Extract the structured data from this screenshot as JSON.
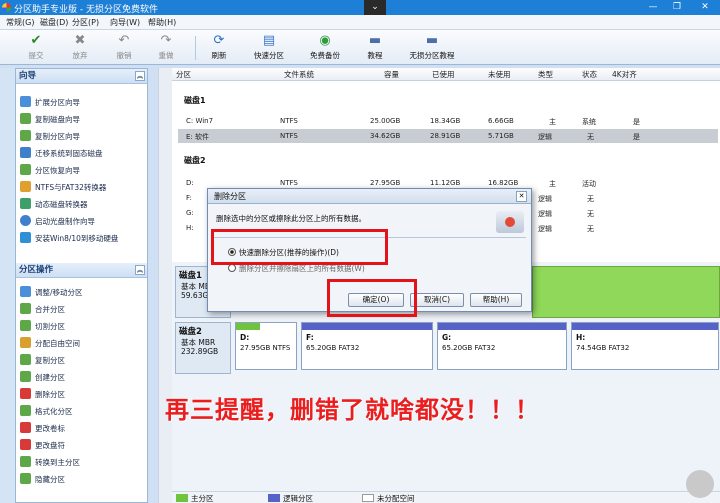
{
  "app": {
    "title": "分区助手专业版 - 无损分区免费软件"
  },
  "menu": [
    "常规(G)",
    "磁盘(D)",
    "分区(P)",
    "向导(W)",
    "帮助(H)"
  ],
  "toolbar": {
    "items": [
      {
        "label": "提交",
        "icon": "check-icon"
      },
      {
        "label": "放弃",
        "icon": "discard-icon"
      },
      {
        "label": "撤销",
        "icon": "undo-icon"
      },
      {
        "label": "重做",
        "icon": "redo-icon"
      },
      {
        "label": "刷新",
        "icon": "refresh-icon"
      },
      {
        "label": "快速分区",
        "icon": "quick-partition-icon"
      },
      {
        "label": "免费备份",
        "icon": "backup-icon"
      },
      {
        "label": "教程",
        "icon": "tutorial-icon"
      },
      {
        "label": "无损分区教程",
        "icon": "lossless-tutorial-icon"
      }
    ]
  },
  "sidebar": {
    "wizard_title": "向导",
    "wizard_items": [
      "扩展分区向导",
      "复制磁盘向导",
      "复制分区向导",
      "迁移系统到固态磁盘",
      "分区恢复向导",
      "NTFS与FAT32转换器",
      "动态磁盘转换器",
      "启动光盘制作向导",
      "安装Win8/10到移动硬盘"
    ],
    "ops_title": "分区操作",
    "ops_items": [
      "调整/移动分区",
      "合并分区",
      "切割分区",
      "分配自由空间",
      "复制分区",
      "创建分区",
      "删除分区",
      "格式化分区",
      "更改卷标",
      "更改盘符",
      "转换到主分区",
      "隐藏分区"
    ]
  },
  "columns": [
    "分区",
    "文件系统",
    "容量",
    "已使用",
    "未使用",
    "类型",
    "状态",
    "4K对齐"
  ],
  "disk1": {
    "name": "磁盘1",
    "rows": [
      {
        "part": "C: Win7",
        "fs": "NTFS",
        "cap": "25.00GB",
        "used": "18.34GB",
        "free": "6.66GB",
        "type": "主",
        "status": "系统",
        "align": "是"
      },
      {
        "part": "E: 软件",
        "fs": "NTFS",
        "cap": "34.62GB",
        "used": "28.91GB",
        "free": "5.71GB",
        "type": "逻辑",
        "status": "无",
        "align": "是"
      }
    ]
  },
  "disk2": {
    "name": "磁盘2",
    "rows": [
      {
        "part": "D:",
        "fs": "NTFS",
        "cap": "27.95GB",
        "used": "11.12GB",
        "free": "16.82GB",
        "type": "主",
        "status": "活动"
      },
      {
        "part": "F:",
        "type": "逻辑",
        "status": "无"
      },
      {
        "part": "G:",
        "type": "逻辑",
        "status": "无"
      },
      {
        "part": "H:",
        "type": "逻辑",
        "status": "无"
      }
    ]
  },
  "diskmap": {
    "disk1": {
      "name": "磁盘1",
      "kind": "基本 MBR",
      "size": "59.63G"
    },
    "disk2": {
      "name": "磁盘2",
      "kind": "基本 MBR",
      "size": "232.89GB",
      "parts": [
        {
          "name": "D:",
          "size": "27.95GB NTFS",
          "fill": 0.4
        },
        {
          "name": "F:",
          "size": "65.20GB FAT32"
        },
        {
          "name": "G:",
          "size": "65.20GB FAT32"
        },
        {
          "name": "H:",
          "size": "74.54GB FAT32"
        }
      ]
    }
  },
  "legend": [
    "主分区",
    "逻辑分区",
    "未分配空间"
  ],
  "dialog": {
    "title": "删除分区",
    "message": "删除选中的分区或擦除此分区上的所有数据。",
    "option1": "快速删除分区(推荐的操作)(D)",
    "option2": "删除分区并擦除扇区上的所有数据(W)",
    "ok": "确定(O)",
    "cancel": "取消(C)",
    "help": "帮助(H)"
  },
  "banner": "再三提醒，删错了就啥都没！！！",
  "colors": {
    "accent": "#1d7fd6",
    "alert": "#e2141a",
    "primary_part": "#6fc33d",
    "logical_part": "#5662c8"
  }
}
